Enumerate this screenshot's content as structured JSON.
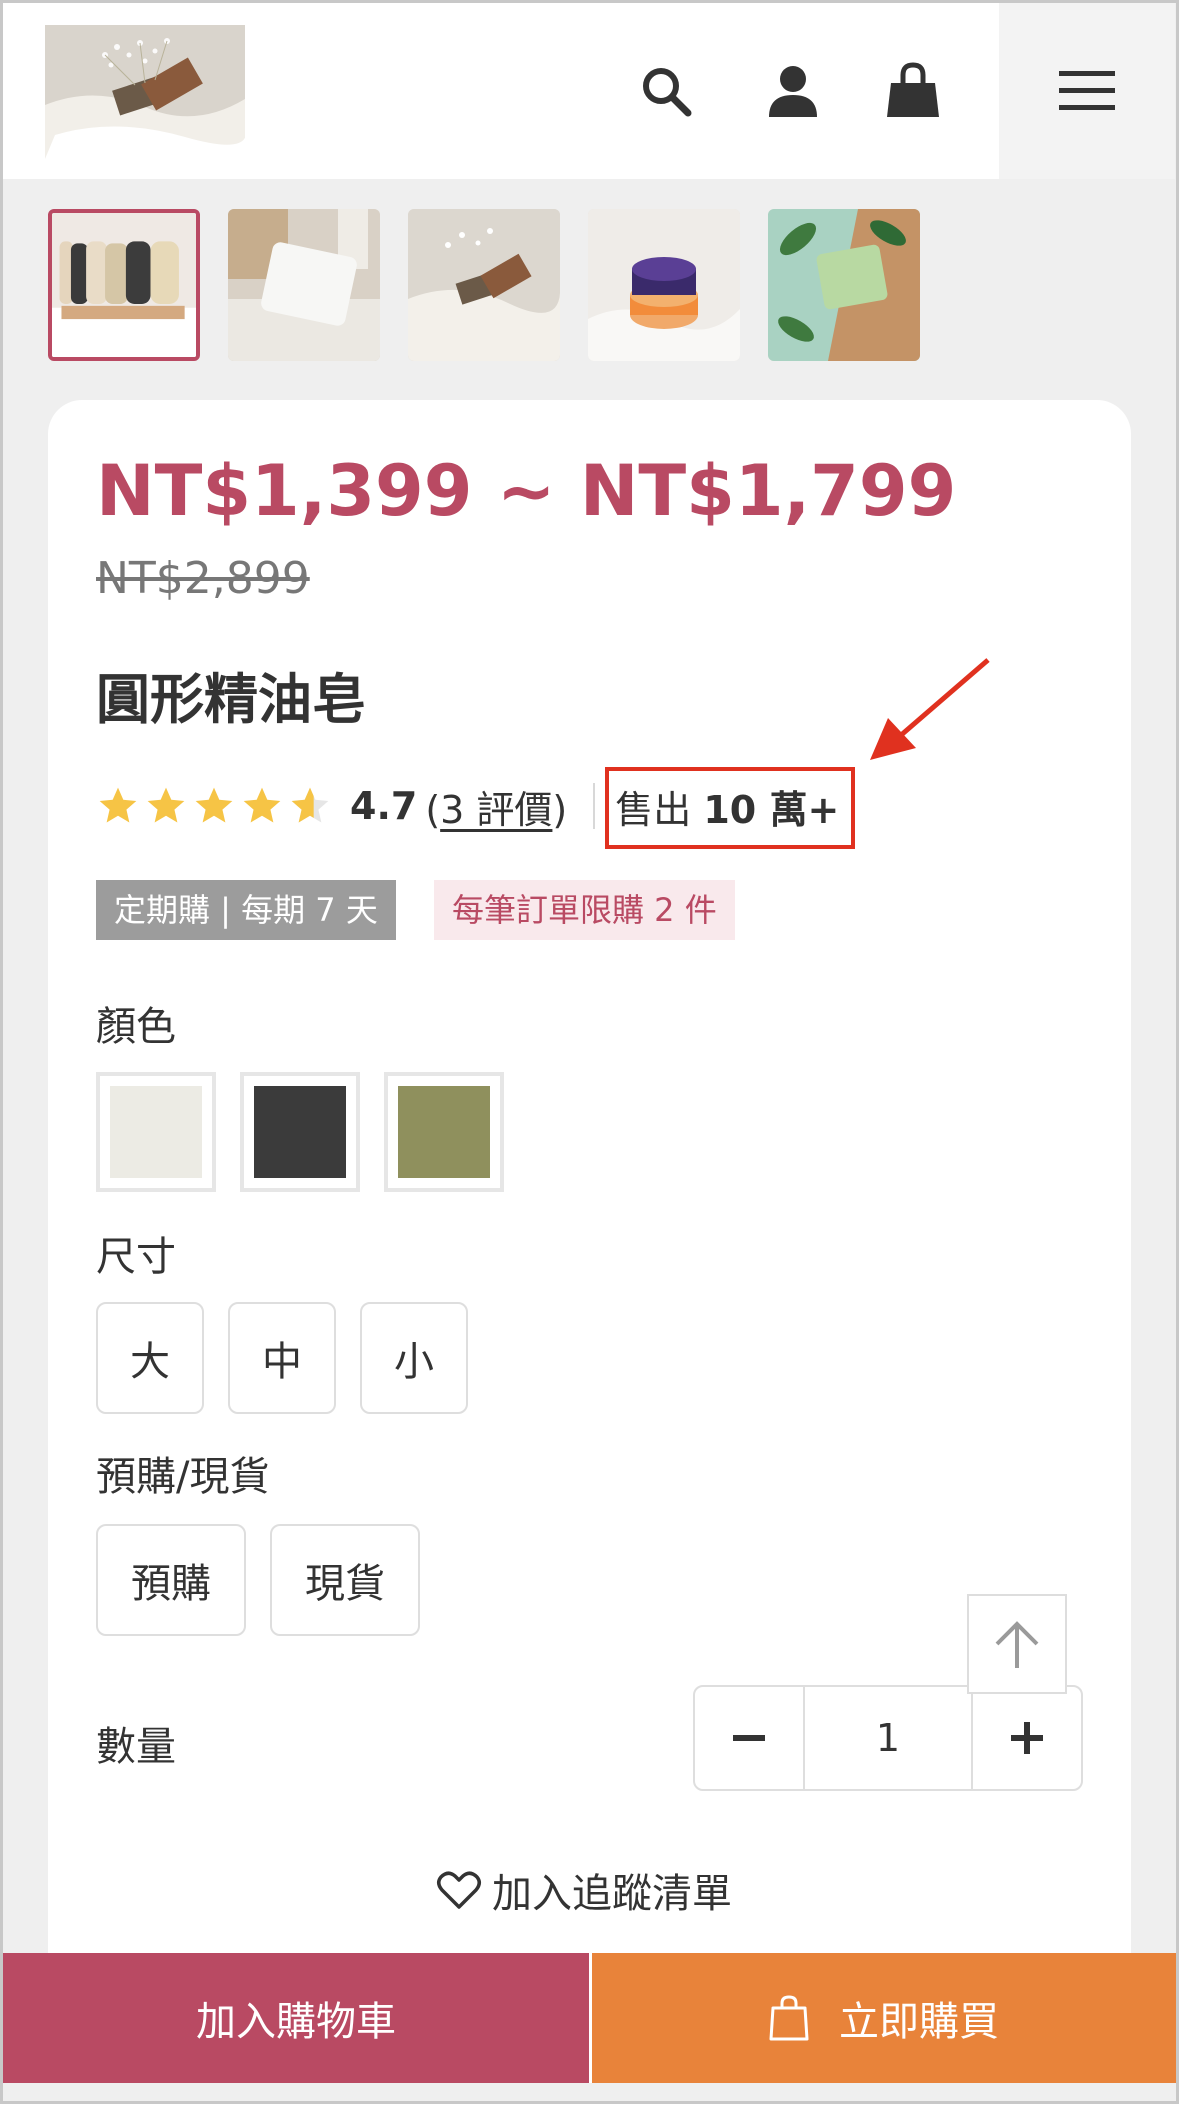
{
  "header": {
    "logo_icon": "soap-photo-logo",
    "search_icon": "search-icon",
    "account_icon": "user-icon",
    "cart_icon": "shopping-bag-icon",
    "menu_icon": "hamburger-menu-icon"
  },
  "gallery": {
    "thumbnails": [
      {
        "name": "soap-bars-row"
      },
      {
        "name": "white-soap-bar"
      },
      {
        "name": "soap-with-flowers"
      },
      {
        "name": "stacked-colored-soaps"
      },
      {
        "name": "green-soap-with-leaves"
      }
    ],
    "active_index": 0
  },
  "product": {
    "price": "NT$1,399 ~ NT$1,799",
    "original_price": "NT$2,899",
    "title": "圓形精油皂",
    "rating_value": "4.7",
    "rating_stars": 4.7,
    "rating_open_paren": "(",
    "review_link": "3 評價",
    "rating_close_paren": ")",
    "sold_prefix": "售出",
    "sold_count": "10 萬+",
    "tags": {
      "subscription": "定期購 | 每期 7 天",
      "limit": "每筆訂單限購 2 件"
    }
  },
  "options": {
    "color_label": "顏色",
    "colors": [
      "#ecebe4",
      "#3b3b3b",
      "#8f905d"
    ],
    "size_label": "尺寸",
    "sizes": [
      "大",
      "中",
      "小"
    ],
    "stock_label": "預購/現貨",
    "stock_options": [
      "預購",
      "現貨"
    ],
    "quantity_label": "數量",
    "quantity_value": "1"
  },
  "wishlist": {
    "label": "加入追蹤清單"
  },
  "actions": {
    "add_to_cart": "加入購物車",
    "buy_now": "立即購買"
  },
  "colors": {
    "brand": "#b94a63",
    "buy_now": "#e8833a",
    "highlight": "#e0311f",
    "star": "#f6c445"
  }
}
